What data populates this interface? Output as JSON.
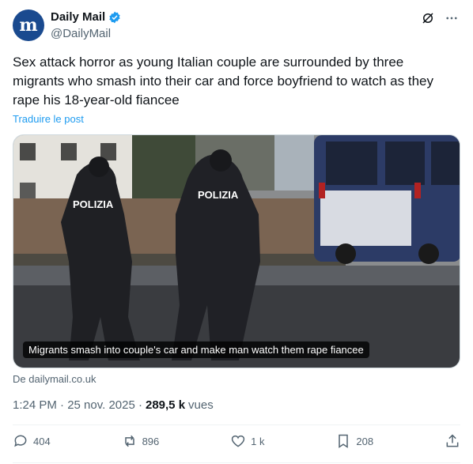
{
  "account": {
    "name": "Daily Mail",
    "handle": "@DailyMail",
    "avatar_letter": "m"
  },
  "tweet": {
    "text": "Sex attack horror as young Italian couple are surrounded by three migrants who smash into their car and force boyfriend to watch as they rape his 18-year-old fiancee",
    "translate": "Traduire le post"
  },
  "media": {
    "caption": "Migrants smash into couple's car and make man watch them rape fiancee",
    "sign_1": "POLIZIA",
    "sign_2": "POLIZIA"
  },
  "source": "De dailymail.co.uk",
  "meta": {
    "time": "1:24 PM · 25 nov. 2025 ·",
    "views": "289,5 k",
    "views_label": "vues"
  },
  "actions": {
    "replies": "404",
    "reposts": "896",
    "likes": "1 k",
    "bookmarks": "208"
  },
  "colors": {
    "accent": "#1d9bf0",
    "text": "#0f1419",
    "muted": "#536471"
  }
}
